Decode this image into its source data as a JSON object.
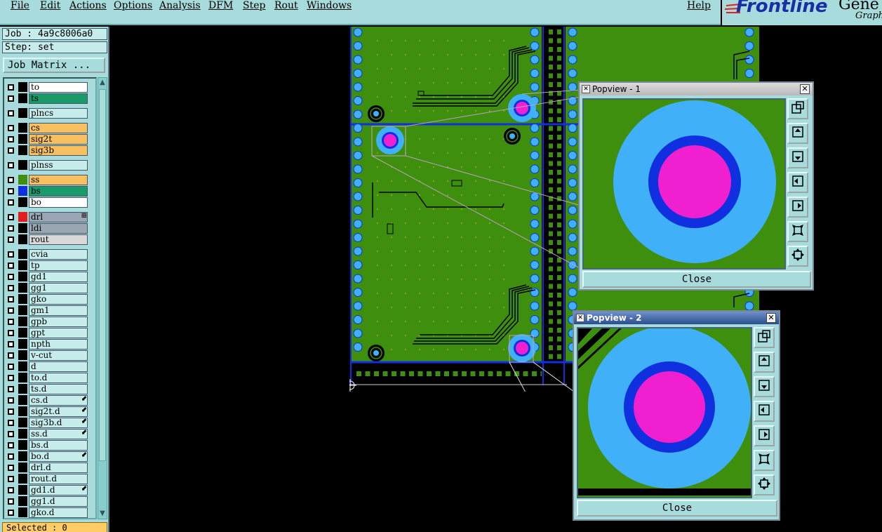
{
  "menubar": {
    "items": [
      "File",
      "Edit",
      "Actions",
      "Options",
      "Analysis",
      "DFM",
      "Step",
      "Rout",
      "Windows"
    ],
    "help": "Help"
  },
  "logo": {
    "brand": "Frontline",
    "product": "Gene",
    "tagline": "Graph"
  },
  "sidebar": {
    "job": "Job : 4a9c8006a0",
    "step": "Step: set",
    "job_matrix_button": "Job Matrix ...",
    "selected": "Selected : 0",
    "layers": [
      {
        "name": "to",
        "bg": "#ffffff",
        "swatch": "#000000",
        "mark": ""
      },
      {
        "name": "ts",
        "bg": "#1a9a6a",
        "swatch": "#000000",
        "mark": ""
      },
      {
        "name": "plncs",
        "bg": "#c6ecec",
        "swatch": "#000000",
        "mark": ""
      },
      {
        "name": "cs",
        "bg": "#f8c060",
        "swatch": "#000000",
        "mark": ""
      },
      {
        "name": "sig2t",
        "bg": "#f8c060",
        "swatch": "#000000",
        "mark": ""
      },
      {
        "name": "sig3b",
        "bg": "#f8c060",
        "swatch": "#000000",
        "mark": ""
      },
      {
        "name": "plnss",
        "bg": "#c6ecec",
        "swatch": "#000000",
        "mark": ""
      },
      {
        "name": "ss",
        "bg": "#f8c060",
        "swatch": "#3d8f0d",
        "mark": ""
      },
      {
        "name": "bs",
        "bg": "#1a9a6a",
        "swatch": "#1030e0",
        "mark": ""
      },
      {
        "name": "bo",
        "bg": "#ffffff",
        "swatch": "#000000",
        "mark": ""
      },
      {
        "name": "drl",
        "bg": "#9aa6b4",
        "swatch": "#e02020",
        "mark": "⊞"
      },
      {
        "name": "ldi",
        "bg": "#9aa6b4",
        "swatch": "#000000",
        "mark": ""
      },
      {
        "name": "rout",
        "bg": "#d8d8d8",
        "swatch": "#000000",
        "mark": ""
      },
      {
        "name": "cvia",
        "bg": "#c6ecec",
        "swatch": "#000000",
        "mark": ""
      },
      {
        "name": "tp",
        "bg": "#c6ecec",
        "swatch": "#000000",
        "mark": ""
      },
      {
        "name": "gd1",
        "bg": "#c6ecec",
        "swatch": "#000000",
        "mark": ""
      },
      {
        "name": "gg1",
        "bg": "#c6ecec",
        "swatch": "#000000",
        "mark": ""
      },
      {
        "name": "gko",
        "bg": "#c6ecec",
        "swatch": "#000000",
        "mark": ""
      },
      {
        "name": "gm1",
        "bg": "#c6ecec",
        "swatch": "#000000",
        "mark": ""
      },
      {
        "name": "gpb",
        "bg": "#c6ecec",
        "swatch": "#000000",
        "mark": ""
      },
      {
        "name": "gpt",
        "bg": "#c6ecec",
        "swatch": "#000000",
        "mark": ""
      },
      {
        "name": "npth",
        "bg": "#c6ecec",
        "swatch": "#000000",
        "mark": ""
      },
      {
        "name": "v-cut",
        "bg": "#c6ecec",
        "swatch": "#000000",
        "mark": ""
      },
      {
        "name": "d",
        "bg": "#c6ecec",
        "swatch": "#000000",
        "mark": ""
      },
      {
        "name": "to.d",
        "bg": "#c6ecec",
        "swatch": "#000000",
        "mark": ""
      },
      {
        "name": "ts.d",
        "bg": "#c6ecec",
        "swatch": "#000000",
        "mark": ""
      },
      {
        "name": "cs.d",
        "bg": "#c6ecec",
        "swatch": "#000000",
        "mark": "⬋"
      },
      {
        "name": "sig2t.d",
        "bg": "#c6ecec",
        "swatch": "#000000",
        "mark": "⬋"
      },
      {
        "name": "sig3b.d",
        "bg": "#c6ecec",
        "swatch": "#000000",
        "mark": "⬋"
      },
      {
        "name": "ss.d",
        "bg": "#c6ecec",
        "swatch": "#000000",
        "mark": "⬋"
      },
      {
        "name": "bs.d",
        "bg": "#c6ecec",
        "swatch": "#000000",
        "mark": ""
      },
      {
        "name": "bo.d",
        "bg": "#c6ecec",
        "swatch": "#000000",
        "mark": "⬋"
      },
      {
        "name": "drl.d",
        "bg": "#c6ecec",
        "swatch": "#000000",
        "mark": ""
      },
      {
        "name": "rout.d",
        "bg": "#c6ecec",
        "swatch": "#000000",
        "mark": ""
      },
      {
        "name": "gd1.d",
        "bg": "#c6ecec",
        "swatch": "#000000",
        "mark": "⬋"
      },
      {
        "name": "gg1.d",
        "bg": "#c6ecec",
        "swatch": "#000000",
        "mark": ""
      },
      {
        "name": "gko.d",
        "bg": "#c6ecec",
        "swatch": "#000000",
        "mark": ""
      }
    ]
  },
  "popview1": {
    "title": "Popview - 1",
    "close_label": "Close"
  },
  "popview2": {
    "title": "Popview - 2",
    "close_label": "Close"
  },
  "popview_tools": [
    "zoom-fit-icon",
    "pan-up-icon",
    "pan-down-icon",
    "pan-left-icon",
    "pan-right-icon",
    "zoom-out-icon",
    "zoom-in-icon"
  ],
  "colors": {
    "panel": "#a8dcdc",
    "board_green": "#3d8f0d",
    "pad_light_blue": "#40b0f8",
    "pad_blue": "#1030e0",
    "pad_magenta": "#f020d0"
  }
}
